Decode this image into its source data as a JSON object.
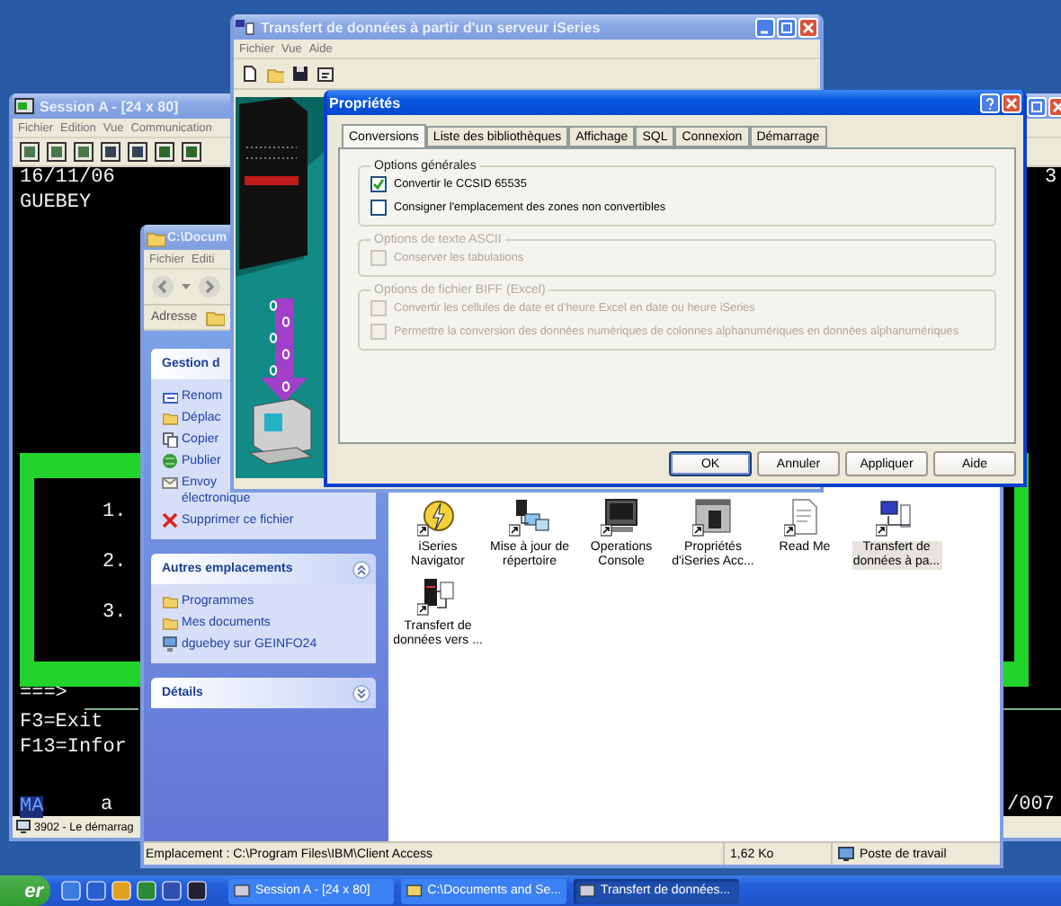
{
  "session_window": {
    "title": "Session A - [24 x 80]",
    "active": false,
    "menu": [
      "Fichier",
      "Edition",
      "Vue",
      "Communication"
    ],
    "terminal": {
      "date": "16/11/06",
      "user": "GUEBEY",
      "right_edge": "3",
      "options": [
        "1.",
        "2.",
        "3."
      ],
      "prompt": "===>",
      "function_keys": [
        "F3=Exit",
        "F13=Infor"
      ],
      "status_row": {
        "left": "MA",
        "middle": "a",
        "right": "/007"
      }
    },
    "status_bar": "3902 - Le démarrag"
  },
  "explorer_window": {
    "title": "C:\\Docum",
    "active": false,
    "menu": [
      "Fichier",
      "Editi"
    ],
    "address_label": "Adresse",
    "task_panels": [
      {
        "title": "Gestion d",
        "items": [
          {
            "kind": "rename",
            "lines": [
              "Renom"
            ]
          },
          {
            "kind": "move",
            "lines": [
              "Déplac"
            ]
          },
          {
            "kind": "copy",
            "lines": [
              "Copier"
            ]
          },
          {
            "kind": "publish",
            "lines": [
              "Publier"
            ]
          },
          {
            "kind": "email",
            "lines": [
              "Envoy",
              "électronique"
            ]
          },
          {
            "kind": "delete",
            "lines": [
              "Supprimer ce fichier"
            ]
          }
        ]
      },
      {
        "title": "Autres emplacements",
        "expanded": true,
        "items": [
          {
            "kind": "programs",
            "lines": [
              "Programmes"
            ]
          },
          {
            "kind": "documents",
            "lines": [
              "Mes documents"
            ]
          },
          {
            "kind": "network",
            "lines": [
              "dguebey sur GEINFO24"
            ]
          }
        ]
      },
      {
        "title": "Détails",
        "expanded": false
      }
    ],
    "files": [
      {
        "name": "iSeries Navigator",
        "kind": "navigator",
        "selected": false
      },
      {
        "name": "Mise à jour de répertoire",
        "kind": "update",
        "selected": false
      },
      {
        "name": "Operations Console",
        "kind": "console",
        "selected": false
      },
      {
        "name": "Propriétés d'iSeries Acc...",
        "kind": "properties",
        "selected": false
      },
      {
        "name": "Read Me",
        "kind": "readme",
        "selected": false
      },
      {
        "name": "Transfert de données à pa...",
        "kind": "transfer_from",
        "selected": true
      },
      {
        "name": "Transfert de données vers ...",
        "kind": "transfer_to",
        "selected": false
      }
    ],
    "status_bar": {
      "location": "Emplacement : C:\\Program Files\\IBM\\Client Access",
      "size": "1,62 Ko",
      "zone": "Poste de travail"
    }
  },
  "transfer_window": {
    "title": "Transfert de données à partir d'un serveur iSeries",
    "active": false,
    "menu": [
      "Fichier",
      "Vue",
      "Aide"
    ]
  },
  "properties_dialog": {
    "title": "Propriétés",
    "active": true,
    "tabs": [
      {
        "label": "Conversions",
        "selected": true
      },
      {
        "label": "Liste des bibliothèques",
        "selected": false
      },
      {
        "label": "Affichage",
        "selected": false
      },
      {
        "label": "SQL",
        "selected": false
      },
      {
        "label": "Connexion",
        "selected": false
      },
      {
        "label": "Démarrage",
        "selected": false
      }
    ],
    "groups": [
      {
        "title": "Options générales",
        "disabled": false,
        "options": [
          {
            "label": "Convertir le CCSID 65535",
            "checked": true
          },
          {
            "label": "Consigner l'emplacement des zones non convertibles",
            "checked": false
          }
        ]
      },
      {
        "title": "Options de texte ASCII",
        "disabled": true,
        "options": [
          {
            "label": "Conserver les tabulations",
            "checked": false
          }
        ]
      },
      {
        "title": "Options de fichier BIFF (Excel)",
        "disabled": true,
        "options": [
          {
            "label": "Convertir les cellules de date et d'heure Excel en date ou heure iSeries",
            "checked": false
          },
          {
            "label": "Permettre la conversion des données numériques de colonnes alphanumériques en données alphanumériques",
            "checked": false
          }
        ]
      }
    ],
    "buttons": [
      {
        "label": "OK",
        "default": true
      },
      {
        "label": "Annuler",
        "default": false
      },
      {
        "label": "Appliquer",
        "default": false
      },
      {
        "label": "Aide",
        "default": false
      }
    ]
  },
  "taskbar": {
    "start_label": "er",
    "tasks": [
      {
        "label": "Session A - [24 x 80]",
        "selected": false
      },
      {
        "label": "C:\\Documents and Se...",
        "selected": false
      },
      {
        "label": "Transfert de données...",
        "selected": true
      }
    ]
  }
}
